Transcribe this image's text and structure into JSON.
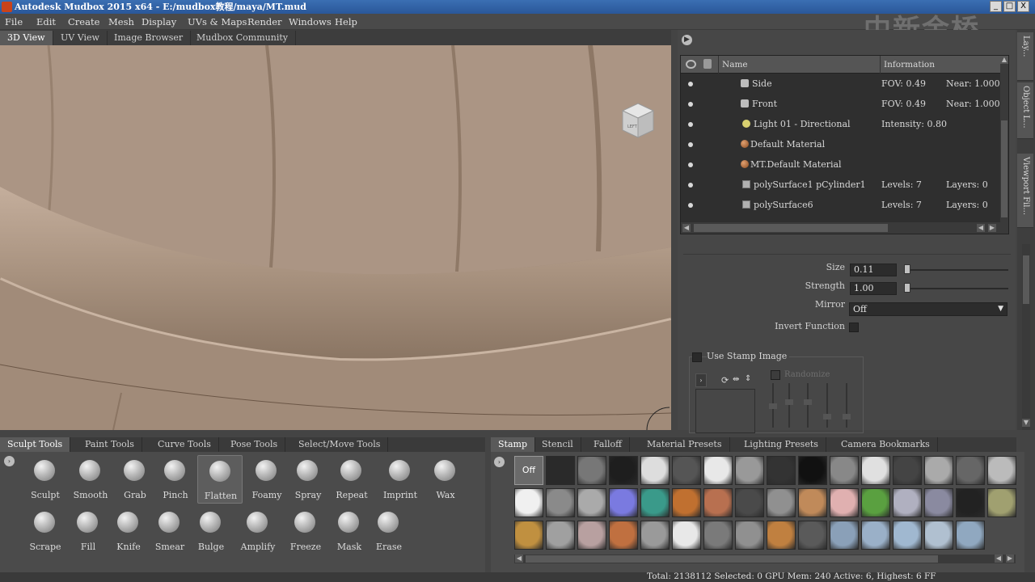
{
  "window": {
    "title": "Autodesk Mudbox 2015 x64 - E:/mudbox教程/maya/MT.mud",
    "minimize": "_",
    "maximize": "□",
    "close": "X",
    "watermark": "中新金桥"
  },
  "menu": [
    "File",
    "Edit",
    "Create",
    "Mesh",
    "Display",
    "UVs & Maps",
    "Render",
    "Windows",
    "Help"
  ],
  "viewport_tabs": [
    "3D View",
    "UV View",
    "Image Browser",
    "Mudbox Community"
  ],
  "view_cube_label": "LEFT",
  "object_list": {
    "columns": {
      "name": "Name",
      "info": "Information"
    },
    "rows": [
      {
        "name": "Side",
        "info1": "FOV: 0.49",
        "info2": "Near: 1.000",
        "icon": "camera-icon"
      },
      {
        "name": "Front",
        "info1": "FOV: 0.49",
        "info2": "Near: 1.000",
        "icon": "camera-icon"
      },
      {
        "name": "Light 01 - Directional",
        "info1": "Intensity: 0.80",
        "info2": "",
        "icon": "light-bulb-icon"
      },
      {
        "name": "Default Material",
        "info1": "",
        "info2": "",
        "icon": "material-icon"
      },
      {
        "name": "MT.Default Material",
        "info1": "",
        "info2": "",
        "icon": "material-icon"
      },
      {
        "name": "polySurface1 pCylinder1",
        "info1": "Levels: 7",
        "info2": "Layers: 0",
        "icon": "mesh-icon"
      },
      {
        "name": "polySurface6",
        "info1": "Levels: 7",
        "info2": "Layers: 0",
        "icon": "mesh-icon"
      }
    ]
  },
  "properties": {
    "size_label": "Size",
    "size_value": "0.11",
    "strength_label": "Strength",
    "strength_value": "1.00",
    "mirror_label": "Mirror",
    "mirror_value": "Off",
    "invert_label": "Invert Function",
    "use_stamp_label": "Use Stamp Image",
    "randomize_label": "Randomize"
  },
  "right_tabs": [
    "Lay...",
    "Object L...",
    "Viewport Fil..."
  ],
  "tool_tabs": [
    "Sculpt Tools",
    "Paint Tools",
    "Curve Tools",
    "Pose Tools",
    "Select/Move Tools"
  ],
  "tools_row1": [
    "Sculpt",
    "Smooth",
    "Grab",
    "Pinch",
    "Flatten",
    "Foamy",
    "Spray",
    "Repeat",
    "Imprint",
    "Wax"
  ],
  "tools_row2": [
    "Scrape",
    "Fill",
    "Knife",
    "Smear",
    "Bulge",
    "Amplify",
    "Freeze",
    "Mask",
    "Erase"
  ],
  "active_tool": "Flatten",
  "stamp_tabs": [
    "Stamp",
    "Stencil",
    "Falloff",
    "Material Presets",
    "Lighting Presets",
    "Camera Bookmarks"
  ],
  "stamp_off_label": "Off",
  "status": "Total: 2138112  Selected: 0 GPU Mem: 240  Active: 6, Highest: 6  FF"
}
